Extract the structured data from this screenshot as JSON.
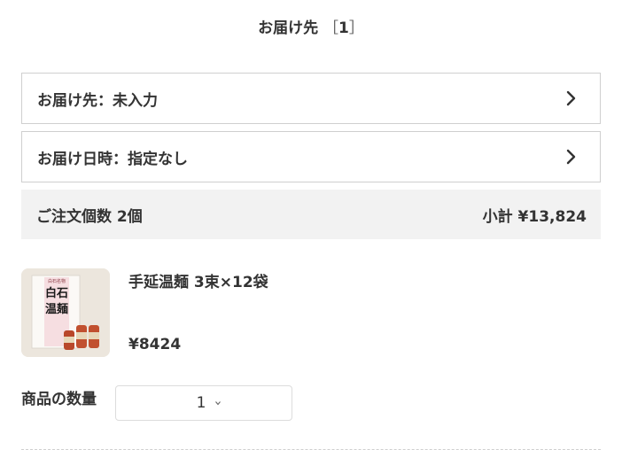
{
  "section": {
    "title": "お届け先",
    "open_bracket": "［",
    "count": "1",
    "close_bracket": "］"
  },
  "delivery_address": {
    "label": "お届け先：未入力",
    "icon": "chevron-right-icon"
  },
  "delivery_datetime": {
    "label": "お届け日時：指定なし",
    "icon": "chevron-right-icon"
  },
  "summary": {
    "order_count": "ご注文個数 2個",
    "subtotal": "小計 ¥13,824"
  },
  "product": {
    "name": "手延温麺 3束×12袋",
    "price": "¥8424",
    "image_text": "白石温麺",
    "image_alt": "product-image"
  },
  "quantity": {
    "label": "商品の数量",
    "selected": "1",
    "icon": "chevron-down-icon"
  },
  "colors": {
    "text": "#333333",
    "border": "#cfcfcf",
    "summary_bg": "#f2f2f2"
  }
}
